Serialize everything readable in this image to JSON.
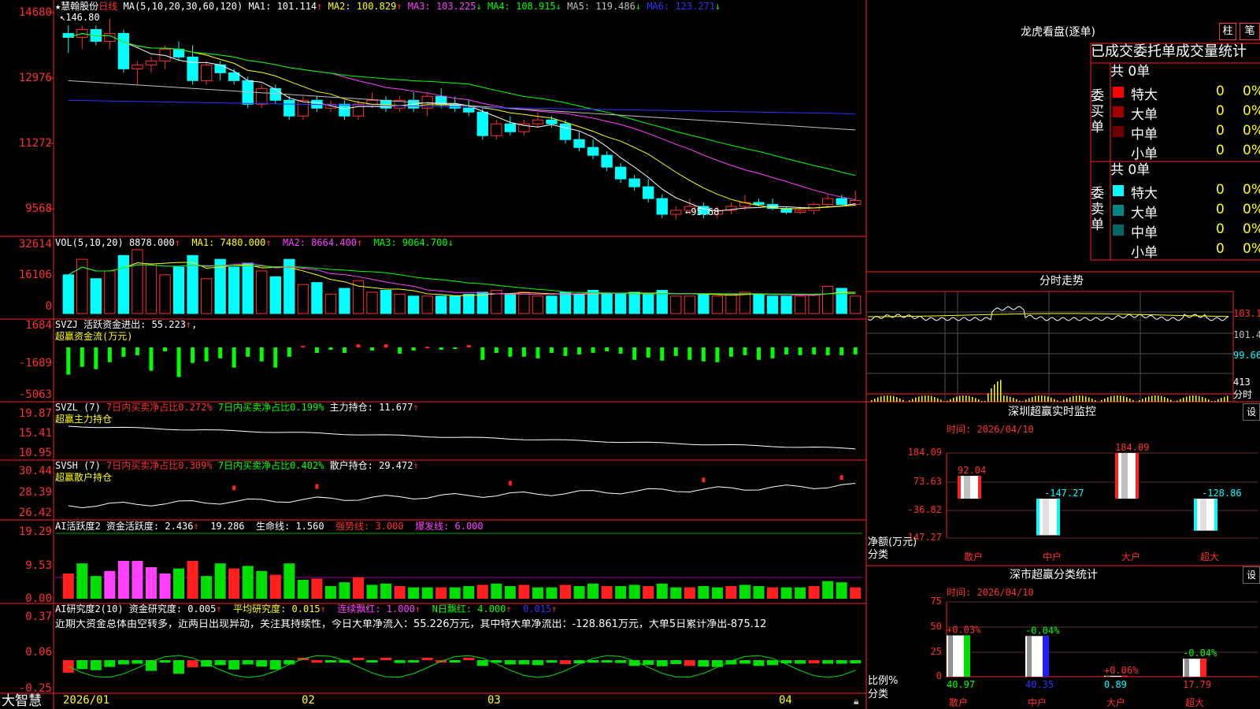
{
  "stock": {
    "star": "★",
    "name": "慧翰股份",
    "period": "日线"
  },
  "kline": {
    "ma_label": "MA(5,10,20,30,60,120)",
    "ma": [
      {
        "label": "MA1: 101.114",
        "arrow": "↑",
        "color": "#ffffff"
      },
      {
        "label": "MA2: 100.829",
        "arrow": "↑",
        "color": "#ffff00"
      },
      {
        "label": "MA3: 103.225",
        "arrow": "↓",
        "color": "#ff40ff"
      },
      {
        "label": "MA4: 108.915",
        "arrow": "↓",
        "color": "#00ff00"
      },
      {
        "label": "MA5: 119.486",
        "arrow": "↓",
        "color": "#c0c0c0"
      },
      {
        "label": "MA6: 123.271",
        "arrow": "↓",
        "color": "#3030ff"
      }
    ],
    "y_ticks": [
      "14680",
      "12976",
      "11272",
      "9568"
    ],
    "high_mark": "146.80",
    "low_mark": "95.68",
    "candles": [
      [
        143,
        145,
        138,
        142
      ],
      [
        142,
        145,
        139,
        144
      ],
      [
        144,
        145,
        140,
        141
      ],
      [
        141,
        146.8,
        139,
        143
      ],
      [
        143,
        144,
        133,
        134
      ],
      [
        134,
        136,
        130,
        135
      ],
      [
        135,
        137,
        133,
        136
      ],
      [
        136,
        140,
        134,
        139
      ],
      [
        139,
        141,
        136,
        137
      ],
      [
        137,
        140,
        130,
        131
      ],
      [
        131,
        136,
        130,
        135
      ],
      [
        135,
        136,
        131,
        133
      ],
      [
        133,
        134,
        130,
        131
      ],
      [
        131,
        132,
        124,
        125
      ],
      [
        125,
        130,
        124,
        129
      ],
      [
        129,
        130,
        125,
        126
      ],
      [
        126,
        127,
        121,
        122
      ],
      [
        122,
        127,
        121,
        126
      ],
      [
        126,
        127,
        123,
        124
      ],
      [
        124,
        126,
        123,
        125
      ],
      [
        125,
        126,
        121,
        122
      ],
      [
        122,
        126,
        121,
        125
      ],
      [
        125,
        128,
        124,
        126
      ],
      [
        126,
        127,
        123,
        124
      ],
      [
        124,
        127,
        123,
        126
      ],
      [
        126,
        128,
        123,
        124
      ],
      [
        124,
        128,
        122,
        127
      ],
      [
        127,
        129,
        124,
        125
      ],
      [
        125,
        127,
        123,
        124
      ],
      [
        124,
        126,
        122,
        123
      ],
      [
        123,
        124,
        116,
        117
      ],
      [
        117,
        121,
        116,
        120
      ],
      [
        120,
        122,
        117,
        118
      ],
      [
        118,
        121,
        117,
        120
      ],
      [
        120,
        123,
        119,
        121
      ],
      [
        121,
        122,
        119,
        120
      ],
      [
        120,
        121,
        115,
        116
      ],
      [
        116,
        118,
        113,
        114
      ],
      [
        114,
        116,
        111,
        112
      ],
      [
        112,
        113,
        108,
        109
      ],
      [
        109,
        110,
        105,
        106
      ],
      [
        106,
        107,
        103,
        104
      ],
      [
        104,
        106,
        100,
        101
      ],
      [
        101,
        102,
        96,
        97
      ],
      [
        97,
        99,
        95.68,
        98
      ],
      [
        98,
        101,
        97,
        99
      ],
      [
        99,
        100,
        96,
        97
      ],
      [
        97,
        99,
        96,
        98
      ],
      [
        98,
        100,
        97,
        99
      ],
      [
        99,
        102,
        98,
        100
      ],
      [
        100,
        101,
        99,
        99.5
      ],
      [
        99.5,
        101,
        98,
        98.5
      ],
      [
        98.5,
        99,
        97,
        97.5
      ],
      [
        97.5,
        99,
        97,
        98
      ],
      [
        98,
        100,
        97,
        99.5
      ],
      [
        99.5,
        102,
        99,
        101
      ],
      [
        101,
        102,
        99,
        99.5
      ],
      [
        99.5,
        103,
        99,
        100.5
      ]
    ]
  },
  "vol": {
    "label": "VOL(5,10,20)",
    "val": "8878.000",
    "ma1": "MA1: 7480.000",
    "ma2": "MA2: 8664.400",
    "ma3": "MA3: 9064.700",
    "y_ticks": [
      "32614",
      "16106",
      "0"
    ],
    "bars": [
      20,
      28,
      18,
      22,
      30,
      33,
      25,
      20,
      24,
      30,
      18,
      28,
      24,
      26,
      22,
      19,
      28,
      15,
      16,
      10,
      13,
      17,
      11,
      12,
      10,
      9,
      9,
      9,
      9,
      10,
      11,
      12,
      10,
      11,
      9,
      9,
      11,
      10,
      12,
      10,
      10,
      11,
      10,
      12,
      9,
      9,
      10,
      9,
      10,
      11,
      10,
      9,
      9,
      9,
      10,
      14,
      13,
      9
    ]
  },
  "svzj": {
    "label": "SVZJ 活跃资金进出: 55.223",
    "sub": "超赢资金流(万元)",
    "y_ticks": [
      "1684",
      "-1689",
      "-5063"
    ],
    "bars": [
      -3500,
      -2500,
      -2800,
      -1900,
      -1200,
      -1000,
      -3000,
      -500,
      -3800,
      -2000,
      -1800,
      -1400,
      -2600,
      -1200,
      -1800,
      -2600,
      -1200,
      200,
      -700,
      -300,
      -700,
      400,
      -400,
      400,
      -800,
      -400,
      100,
      -300,
      -200,
      300,
      -1600,
      -700,
      -1200,
      -1200,
      -1400,
      -700,
      -1100,
      -900,
      -700,
      -500,
      -800,
      -1600,
      -1300,
      -1700,
      -1100,
      -1600,
      -1800,
      -1900,
      -1200,
      -1000,
      -1600,
      -1400,
      -900,
      -1000,
      -900,
      -1000,
      -1000,
      -900
    ]
  },
  "svzl": {
    "label": "SVZL (7)",
    "a": "7日内买卖净占比0.272%",
    "b": "7日内买卖净占比0.199%",
    "c": "主力持仓: 11.677",
    "sub": "超赢主力持仓",
    "y_ticks": [
      "19.87",
      "15.41",
      "10.95"
    ]
  },
  "svsh": {
    "label": "SVSH (7)",
    "a": "7日内买卖净占比0.309%",
    "b": "7日内买卖净占比0.402%",
    "c": "散户持仓: 29.472",
    "sub": "超赢散户持仓",
    "y_ticks": [
      "30.44",
      "28.39",
      "26.42"
    ]
  },
  "ai1": {
    "label": "AI活跃度2",
    "a": "资金活跃度: 2.436",
    "b": "19.286",
    "c": "生命线: 1.560",
    "d": "强势线: 3.000",
    "e": "爆发线: 6.000",
    "y_ticks": [
      "19.29",
      "9.53",
      "0.00"
    ]
  },
  "ai2": {
    "label": "AI研究度2(10)",
    "a": "资金研究度: 0.005",
    "b": "平均研究度: 0.015",
    "c": "连续飘红: 1.000",
    "d": "N日飘红: 4.000",
    "e": "0.015",
    "y_ticks": [
      "0.37",
      "0.06",
      "-0.25"
    ],
    "note": "近期大资金总体由空转多，近两日出现异动，关注其持续性，今日大单净流入：55.226万元，其中特大单净流出：-128.861万元，大单5日累计净出-875.12"
  },
  "dates": {
    "logo": "大智慧",
    "d1": "2026/01",
    "d2": "02",
    "d3": "03",
    "d4": "04"
  },
  "right": {
    "lhb_title": "龙虎看盘(逐单)",
    "btn1": "柱",
    "btn2": "笔",
    "stat_title": "已成交委托单成交量统计",
    "buy": {
      "label": "委买单",
      "total": "共 0单",
      "rows": [
        {
          "name": "特大",
          "v": "0",
          "p": "0%",
          "color": "#ff0000"
        },
        {
          "name": "大单",
          "v": "0",
          "p": "0%",
          "color": "#a00000"
        },
        {
          "name": "中单",
          "v": "0",
          "p": "0%",
          "color": "#700000"
        },
        {
          "name": "小单",
          "v": "0",
          "p": "0%",
          "color": "#000000"
        }
      ]
    },
    "sell": {
      "label": "委卖单",
      "total": "共 0单",
      "rows": [
        {
          "name": "特大",
          "v": "0",
          "p": "0%",
          "color": "#00ffff"
        },
        {
          "name": "大单",
          "v": "0",
          "p": "0%",
          "color": "#008888"
        },
        {
          "name": "中单",
          "v": "0",
          "p": "0%",
          "color": "#006666"
        },
        {
          "name": "小单",
          "v": "0",
          "p": "0%",
          "color": "#000000"
        }
      ]
    },
    "fs_title": "分时走势",
    "fs_ticks": [
      "103.1",
      "101.4",
      "99.66",
      "413"
    ],
    "fs_unit": "分时",
    "sz_title": "深圳超赢实时监控",
    "sz_btn": "设",
    "sz_time": "时间: 2026/04/10",
    "sz_ticks": [
      "184.09",
      "73.63",
      "-36.82",
      "-147.27"
    ],
    "sz_ylabel": "净额(万元)",
    "sz_xlabel": "分类",
    "sz_bars": [
      {
        "cat": "散户",
        "v": 92.04,
        "label": "92.04"
      },
      {
        "cat": "中户",
        "v": -147.27,
        "label": "-147.27"
      },
      {
        "cat": "大户",
        "v": 184.09,
        "label": "184.09"
      },
      {
        "cat": "超大",
        "v": -128.86,
        "label": "-128.86"
      }
    ],
    "cls_title": "深市超赢分类统计",
    "cls_btn": "设",
    "cls_time": "时间: 2026/04/10",
    "cls_ticks": [
      "75",
      "50",
      "25",
      "0"
    ],
    "cls_ylabel": "比例%",
    "cls_xlabel": "分类",
    "cls_bars": [
      {
        "cat": "散户",
        "v": 40.97,
        "label": "40.97",
        "chg": "+0.03%"
      },
      {
        "cat": "中户",
        "v": 40.35,
        "label": "40.35",
        "chg": "-0.04%"
      },
      {
        "cat": "大户",
        "v": 0.89,
        "label": "0.89",
        "chg": "+0.06%"
      },
      {
        "cat": "超大",
        "v": 17.79,
        "label": "17.79",
        "chg": "-0.04%"
      }
    ]
  }
}
